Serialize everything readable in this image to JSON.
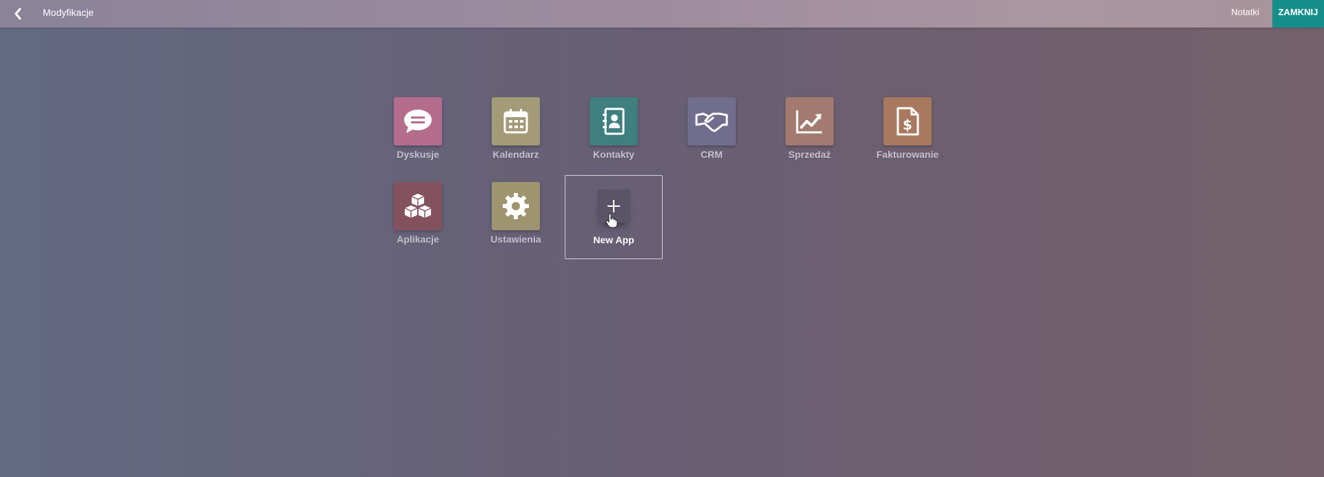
{
  "header": {
    "title": "Modyfikacje",
    "back_icon": "chevron-left-icon",
    "notes_label": "Notatki",
    "close_label": "ZAMKNIJ",
    "close_color": "#168e8a"
  },
  "apps": [
    {
      "label": "Dyskusje",
      "icon": "chat-bubble-icon",
      "color": "#b46d8c"
    },
    {
      "label": "Kalendarz",
      "icon": "calendar-icon",
      "color": "#a39a78"
    },
    {
      "label": "Kontakty",
      "icon": "address-book-icon",
      "color": "#3f7f80"
    },
    {
      "label": "CRM",
      "icon": "handshake-icon",
      "color": "#716d8c"
    },
    {
      "label": "Sprzedaż",
      "icon": "trend-chart-icon",
      "color": "#a27a6f"
    },
    {
      "label": "Fakturowanie",
      "icon": "invoice-dollar-icon",
      "color": "#a8785f"
    },
    {
      "label": "Aplikacje",
      "icon": "cubes-icon",
      "color": "#84525f"
    },
    {
      "label": "Ustawienia",
      "icon": "gear-icon",
      "color": "#9e9470"
    }
  ],
  "new_app": {
    "label": "New App",
    "icon": "plus-icon"
  }
}
